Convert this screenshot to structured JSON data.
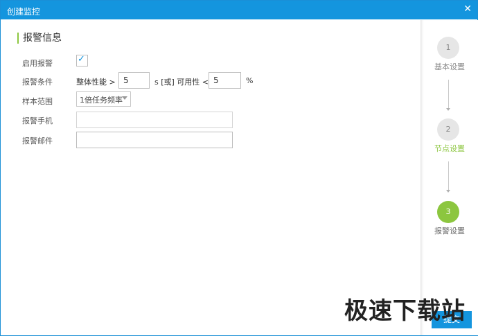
{
  "window": {
    "title": "创建监控"
  },
  "section": {
    "title": "报警信息"
  },
  "form": {
    "enable_label": "启用报警",
    "enable_checked": true,
    "condition_label": "报警条件",
    "overall_text": "整体性能 >",
    "overall_value": "5",
    "or_text": "s [或] 可用性 <",
    "availability_value": "5",
    "percent_text": "%",
    "sample_label": "样本范围",
    "sample_value": "1倍任务频率",
    "phone_label": "报警手机",
    "phone_value": "",
    "email_label": "报警邮件",
    "email_value": ""
  },
  "steps": [
    {
      "number": "1",
      "label": "基本设置",
      "state": "inactive",
      "label_color": "#888888"
    },
    {
      "number": "2",
      "label": "节点设置",
      "state": "done",
      "label_color": "#8cc63f"
    },
    {
      "number": "3",
      "label": "报警设置",
      "state": "active",
      "label_color": "#666666"
    }
  ],
  "footer": {
    "submit_label": "提交"
  },
  "watermark": "极速下载站",
  "colors": {
    "titlebar": "#1495de",
    "accent": "#8cc63f"
  }
}
